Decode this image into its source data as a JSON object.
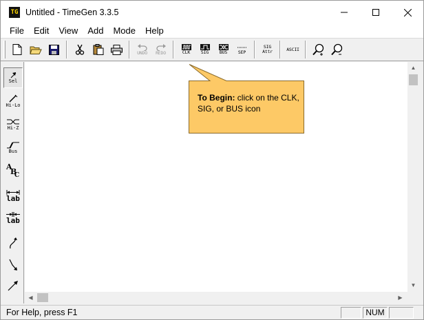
{
  "window": {
    "icon_text": "TG",
    "title": "Untitled - TimeGen 3.3.5"
  },
  "menu": [
    "File",
    "Edit",
    "View",
    "Add",
    "Mode",
    "Help"
  ],
  "toolbar": {
    "undo_caption": "UNDO",
    "redo_caption": "REDO",
    "clk_caption": "CLK",
    "sig_caption": "SIG",
    "bus_caption": "BUS",
    "sep_caption": "SEP",
    "sig_attr_caption_1": "SIG",
    "sig_attr_caption_2": "Attr",
    "ascii_caption": "ASCII"
  },
  "palette": {
    "select_caption": "Sel",
    "hilo_caption": "Hi-Lo",
    "hiz_caption": "Hi-Z",
    "bus_caption": "Bus",
    "lab1_text": "lab",
    "lab2_text": "lab",
    "abc_a": "A",
    "abc_b": "B",
    "abc_c": "C"
  },
  "callout": {
    "bold_text": "To Begin:",
    "text": " click on the CLK, SIG, or BUS icon",
    "fill_color": "#fdc966",
    "border_color": "#8a6a2a"
  },
  "status": {
    "help_text": "For Help, press F1",
    "num_indicator": "NUM"
  }
}
